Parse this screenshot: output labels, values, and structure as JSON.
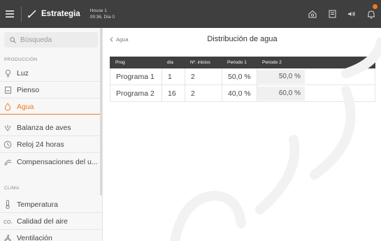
{
  "header": {
    "app_title": "Estrategia",
    "house_line1": "House 1",
    "house_line2": "09:36, Día 0"
  },
  "search": {
    "placeholder": "Búsqueda"
  },
  "sidebar": {
    "section_production": "PRODUCCIÓN",
    "section_climate": "CLIMA",
    "items": [
      {
        "label": "Luz",
        "icon": "bulb-icon"
      },
      {
        "label": "Pienso",
        "icon": "feed-icon"
      },
      {
        "label": "Agua",
        "icon": "water-drop-icon"
      },
      {
        "label": "Balanza de aves",
        "icon": "bird-scale-icon"
      },
      {
        "label": "Reloj 24 horas",
        "icon": "clock-icon"
      },
      {
        "label": "Compensaciones del u...",
        "icon": "compensation-icon"
      },
      {
        "label": "Temperatura",
        "icon": "thermometer-icon"
      },
      {
        "label": "Calidad del aire",
        "icon": "air-quality-icon"
      },
      {
        "label": "Ventilación",
        "icon": "ventilation-icon"
      }
    ]
  },
  "main": {
    "back_label": "Agua",
    "title": "Distribución de agua",
    "columns": [
      "Prog",
      "día",
      "Nº. inicios",
      "Periodo 1",
      "Periodo 2"
    ],
    "rows": [
      {
        "prog": "Programa 1",
        "dia": "1",
        "inicios": "2",
        "periodo1": "50,0 %",
        "periodo2": "50,0 %"
      },
      {
        "prog": "Programa 2",
        "dia": "16",
        "inicios": "2",
        "periodo1": "40,0 %",
        "periodo2": "60,0 %"
      }
    ]
  },
  "colors": {
    "accent": "#f07b1a",
    "header_bg": "#3f3f3f"
  }
}
